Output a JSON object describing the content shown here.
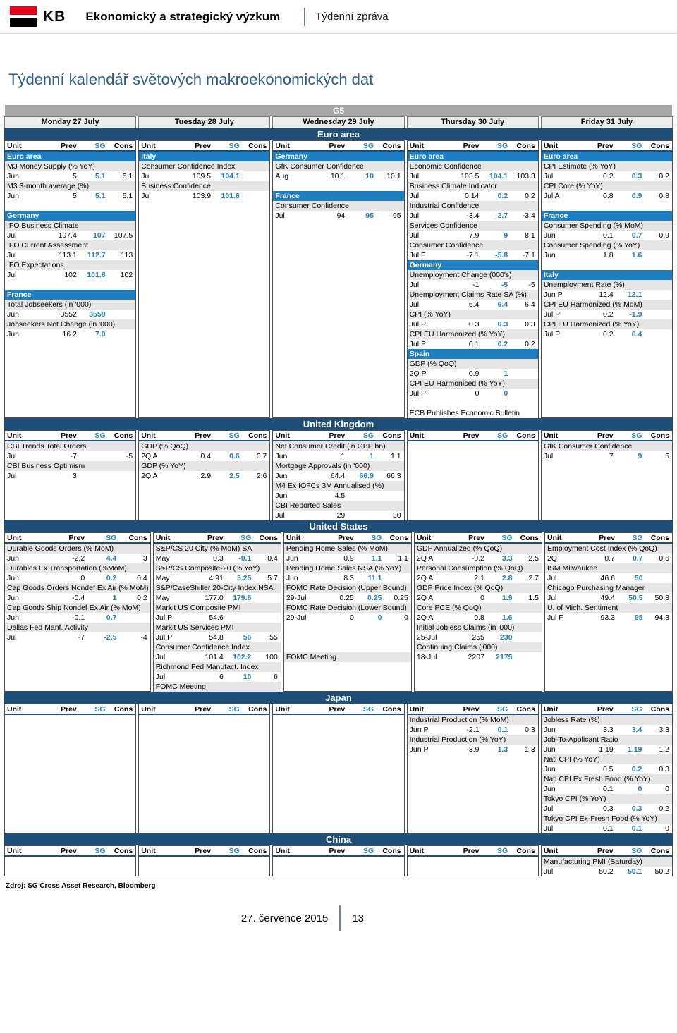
{
  "header": {
    "logo_text": "KB",
    "title": "Ekonomický a strategický výzkum",
    "subtitle": "Týdenní zpráva"
  },
  "page_title": "Týdenní kalendář světových makroekonomických dat",
  "group_band": "G5",
  "days": [
    "Monday 27 July",
    "Tuesday 28 July",
    "Wednesday 29 July",
    "Thursday 30 July",
    "Friday 31 July"
  ],
  "columns": {
    "unit": "Unit",
    "prev": "Prev",
    "sg": "SG",
    "cons": "Cons"
  },
  "regions": {
    "euro": "Euro area",
    "uk": "United Kingdom",
    "us": "United States",
    "japan": "Japan",
    "china": "China"
  },
  "euro_area": {
    "mon": [
      {
        "type": "sub",
        "text": "Euro area"
      },
      {
        "type": "evt",
        "text": "M3 Money Supply (% YoY)"
      },
      {
        "type": "val",
        "unit": "Jun",
        "prev": "5",
        "sg": "5.1",
        "cons": "5.1"
      },
      {
        "type": "evt",
        "text": "M3 3-month average (%)"
      },
      {
        "type": "val",
        "unit": "Jun",
        "prev": "5",
        "sg": "5.1",
        "cons": "5.1"
      },
      {
        "type": "spacer"
      },
      {
        "type": "sub",
        "text": "Germany"
      },
      {
        "type": "evt",
        "text": "IFO Business Climate"
      },
      {
        "type": "val",
        "unit": "Jul",
        "prev": "107.4",
        "sg": "107",
        "cons": "107.5"
      },
      {
        "type": "evt",
        "text": "IFO Current Assessment"
      },
      {
        "type": "val",
        "unit": "Jul",
        "prev": "113.1",
        "sg": "112.7",
        "cons": "113"
      },
      {
        "type": "evt",
        "text": "IFO Expectations"
      },
      {
        "type": "val",
        "unit": "Jul",
        "prev": "102",
        "sg": "101.8",
        "cons": "102"
      },
      {
        "type": "spacer"
      },
      {
        "type": "sub",
        "text": "France"
      },
      {
        "type": "evt",
        "text": "Total Jobseekers (in '000)"
      },
      {
        "type": "val",
        "unit": "Jun",
        "prev": "3552",
        "sg": "3559",
        "cons": ""
      },
      {
        "type": "evt",
        "text": "Jobseekers Net Change (in '000)"
      },
      {
        "type": "val",
        "unit": "Jun",
        "prev": "16.2",
        "sg": "7.0",
        "cons": ""
      }
    ],
    "tue": [
      {
        "type": "sub",
        "text": "Italy"
      },
      {
        "type": "evt",
        "text": "Consumer Confidence Index"
      },
      {
        "type": "val",
        "unit": "Jul",
        "prev": "109.5",
        "sg": "104.1",
        "cons": ""
      },
      {
        "type": "evt",
        "text": "Business Confidence"
      },
      {
        "type": "val",
        "unit": "Jul",
        "prev": "103.9",
        "sg": "101.6",
        "cons": ""
      }
    ],
    "wed": [
      {
        "type": "sub",
        "text": "Germany"
      },
      {
        "type": "evt",
        "text": "GfK Consumer Confidence"
      },
      {
        "type": "val",
        "unit": "Aug",
        "prev": "10.1",
        "sg": "10",
        "cons": "10.1"
      },
      {
        "type": "spacer"
      },
      {
        "type": "sub",
        "text": "France"
      },
      {
        "type": "evt",
        "text": "Consumer Confidence"
      },
      {
        "type": "val",
        "unit": "Jul",
        "prev": "94",
        "sg": "95",
        "cons": "95"
      }
    ],
    "thu": [
      {
        "type": "sub",
        "text": "Euro area"
      },
      {
        "type": "evt",
        "text": "Economic Confidence"
      },
      {
        "type": "val",
        "unit": "Jul",
        "prev": "103.5",
        "sg": "104.1",
        "cons": "103.3"
      },
      {
        "type": "evt",
        "text": "Business Climate Indicator"
      },
      {
        "type": "val",
        "unit": "Jul",
        "prev": "0.14",
        "sg": "0.2",
        "cons": "0.2"
      },
      {
        "type": "evt",
        "text": "Industrial Confidence"
      },
      {
        "type": "val",
        "unit": "Jul",
        "prev": "-3.4",
        "sg": "-2.7",
        "cons": "-3.4"
      },
      {
        "type": "evt",
        "text": "Services Confidence"
      },
      {
        "type": "val",
        "unit": "Jul",
        "prev": "7.9",
        "sg": "9",
        "cons": "8.1"
      },
      {
        "type": "evt",
        "text": "Consumer Confidence"
      },
      {
        "type": "val",
        "unit": "Jul F",
        "prev": "-7.1",
        "sg": "-5.8",
        "cons": "-7.1"
      },
      {
        "type": "sub",
        "text": "Germany"
      },
      {
        "type": "evt",
        "text": "Unemployment Change (000's)"
      },
      {
        "type": "val",
        "unit": "Jul",
        "prev": "-1",
        "sg": "-5",
        "cons": "-5"
      },
      {
        "type": "evt",
        "text": "Unemployment Claims Rate SA (%)"
      },
      {
        "type": "val",
        "unit": "Jul",
        "prev": "6.4",
        "sg": "6.4",
        "cons": "6.4"
      },
      {
        "type": "evt",
        "text": "CPI (% YoY)"
      },
      {
        "type": "val",
        "unit": "Jul P",
        "prev": "0.3",
        "sg": "0.3",
        "cons": "0.3"
      },
      {
        "type": "evt",
        "text": "CPI EU Harmonized (% YoY)"
      },
      {
        "type": "val",
        "unit": "Jul P",
        "prev": "0.1",
        "sg": "0.2",
        "cons": "0.2"
      },
      {
        "type": "sub",
        "text": "Spain"
      },
      {
        "type": "evt",
        "text": "GDP (% QoQ)"
      },
      {
        "type": "val",
        "unit": "2Q P",
        "prev": "0.9",
        "sg": "1",
        "cons": ""
      },
      {
        "type": "evt",
        "text": "CPI EU Harmonised (% YoY)"
      },
      {
        "type": "val",
        "unit": "Jul P",
        "prev": "0",
        "sg": "0",
        "cons": ""
      },
      {
        "type": "spacer"
      },
      {
        "type": "note-wide",
        "text": "ECB Publishes Economic Bulletin"
      }
    ],
    "fri": [
      {
        "type": "sub",
        "text": "Euro area"
      },
      {
        "type": "evt",
        "text": "CPI Estimate (% YoY)"
      },
      {
        "type": "val",
        "unit": "Jul",
        "prev": "0.2",
        "sg": "0.3",
        "cons": "0.2"
      },
      {
        "type": "evt",
        "text": "CPI Core (% YoY)"
      },
      {
        "type": "val",
        "unit": "Jul A",
        "prev": "0.8",
        "sg": "0.9",
        "cons": "0.8"
      },
      {
        "type": "spacer"
      },
      {
        "type": "sub",
        "text": "France"
      },
      {
        "type": "evt",
        "text": "Consumer Spending (% MoM)"
      },
      {
        "type": "val",
        "unit": "Jun",
        "prev": "0.1",
        "sg": "0.7",
        "cons": "0.9"
      },
      {
        "type": "evt",
        "text": "Consumer Spending (% YoY)"
      },
      {
        "type": "val",
        "unit": "Jun",
        "prev": "1.8",
        "sg": "1.6",
        "cons": ""
      },
      {
        "type": "spacer"
      },
      {
        "type": "sub",
        "text": "Italy"
      },
      {
        "type": "evt",
        "text": "Unemployment Rate (%)"
      },
      {
        "type": "val",
        "unit": "Jun P",
        "prev": "12.4",
        "sg": "12.1",
        "cons": ""
      },
      {
        "type": "evt",
        "text": "CPI EU Harmonized (% MoM)"
      },
      {
        "type": "val",
        "unit": "Jul P",
        "prev": "0.2",
        "sg": "-1.9",
        "cons": ""
      },
      {
        "type": "evt",
        "text": "CPI EU Harmonized (% YoY)"
      },
      {
        "type": "val",
        "unit": "Jul P",
        "prev": "0.2",
        "sg": "0.4",
        "cons": ""
      }
    ]
  },
  "uk": {
    "mon": [
      {
        "type": "evt",
        "text": "CBI Trends Total Orders"
      },
      {
        "type": "val",
        "unit": "Jul",
        "prev": "-7",
        "sg": "",
        "cons": "-5"
      },
      {
        "type": "evt",
        "text": "CBI Business Optimism"
      },
      {
        "type": "val",
        "unit": "Jul",
        "prev": "3",
        "sg": "",
        "cons": ""
      }
    ],
    "tue": [
      {
        "type": "evt",
        "text": "GDP (% QoQ)"
      },
      {
        "type": "val",
        "unit": "2Q A",
        "prev": "0.4",
        "sg": "0.6",
        "cons": "0.7"
      },
      {
        "type": "evt",
        "text": "GDP (% YoY)"
      },
      {
        "type": "val",
        "unit": "2Q A",
        "prev": "2.9",
        "sg": "2.5",
        "cons": "2.6"
      }
    ],
    "wed": [
      {
        "type": "evt",
        "text": "Net Consumer Credit (in GBP bn)"
      },
      {
        "type": "val",
        "unit": "Jun",
        "prev": "1",
        "sg": "1",
        "cons": "1.1"
      },
      {
        "type": "evt",
        "text": "Mortgage Approvals (in '000)"
      },
      {
        "type": "val",
        "unit": "Jun",
        "prev": "64.4",
        "sg": "66.9",
        "cons": "66.3"
      },
      {
        "type": "evt",
        "text": "M4 Ex IOFCs 3M Annualised (%)"
      },
      {
        "type": "val",
        "unit": "Jun",
        "prev": "4.5",
        "sg": "",
        "cons": ""
      },
      {
        "type": "evt",
        "text": "CBI Reported Sales"
      },
      {
        "type": "val",
        "unit": "Jul",
        "prev": "29",
        "sg": "",
        "cons": "30"
      }
    ],
    "thu": [],
    "fri": [
      {
        "type": "evt",
        "text": "GfK Consumer Confidence"
      },
      {
        "type": "val",
        "unit": "Jul",
        "prev": "7",
        "sg": "9",
        "cons": "5"
      }
    ]
  },
  "us": {
    "mon": [
      {
        "type": "evt",
        "text": "Durable Goods Orders (% MoM)"
      },
      {
        "type": "val",
        "unit": "Jun",
        "prev": "-2.2",
        "sg": "4.4",
        "cons": "3"
      },
      {
        "type": "evt",
        "text": "Durables Ex Transportation (%MoM)"
      },
      {
        "type": "val",
        "unit": "Jun",
        "prev": "0",
        "sg": "0.2",
        "cons": "0.4"
      },
      {
        "type": "evt",
        "text": "Cap Goods Orders Nondef Ex Air (% MoM)"
      },
      {
        "type": "val",
        "unit": "Jun",
        "prev": "-0.4",
        "sg": "1",
        "cons": "0.2"
      },
      {
        "type": "evt",
        "text": "Cap Goods Ship Nondef Ex Air (% MoM)"
      },
      {
        "type": "val",
        "unit": "Jun",
        "prev": "-0.1",
        "sg": "0.7",
        "cons": ""
      },
      {
        "type": "evt",
        "text": "Dallas Fed Manf. Activity"
      },
      {
        "type": "val",
        "unit": "Jul",
        "prev": "-7",
        "sg": "-2.5",
        "cons": "-4"
      }
    ],
    "tue": [
      {
        "type": "evt",
        "text": "S&P/CS 20 City (% MoM) SA"
      },
      {
        "type": "val",
        "unit": "May",
        "prev": "0.3",
        "sg": "-0.1",
        "cons": "0.4"
      },
      {
        "type": "evt",
        "text": "S&P/CS Composite-20 (% YoY)"
      },
      {
        "type": "val",
        "unit": "May",
        "prev": "4.91",
        "sg": "5.25",
        "cons": "5.7"
      },
      {
        "type": "evt",
        "text": "S&P/CaseShiller 20-City Index NSA"
      },
      {
        "type": "val",
        "unit": "May",
        "prev": "177.0",
        "sg": "179.6",
        "cons": ""
      },
      {
        "type": "evt",
        "text": "Markit US Composite PMI"
      },
      {
        "type": "val",
        "unit": "Jul P",
        "prev": "54.6",
        "sg": "",
        "cons": ""
      },
      {
        "type": "evt",
        "text": "Markit US Services PMI"
      },
      {
        "type": "val",
        "unit": "Jul P",
        "prev": "54.8",
        "sg": "56",
        "cons": "55"
      },
      {
        "type": "evt",
        "text": "Consumer Confidence Index"
      },
      {
        "type": "val",
        "unit": "Jul",
        "prev": "101.4",
        "sg": "102.2",
        "cons": "100"
      },
      {
        "type": "evt",
        "text": "Richmond Fed Manufact. Index"
      },
      {
        "type": "val",
        "unit": "Jul",
        "prev": "6",
        "sg": "10",
        "cons": "6"
      },
      {
        "type": "evt",
        "text": "FOMC Meeting"
      }
    ],
    "wed": [
      {
        "type": "evt",
        "text": "Pending Home Sales (% MoM)"
      },
      {
        "type": "val",
        "unit": "Jun",
        "prev": "0.9",
        "sg": "1.1",
        "cons": "1.1"
      },
      {
        "type": "evt",
        "text": "Pending Home Sales NSA (% YoY)"
      },
      {
        "type": "val",
        "unit": "Jun",
        "prev": "8.3",
        "sg": "11.1",
        "cons": ""
      },
      {
        "type": "evt",
        "text": "FOMC Rate Decision (Upper Bound)"
      },
      {
        "type": "val",
        "unit": "29-Jul",
        "prev": "0.25",
        "sg": "0.25",
        "cons": "0.25"
      },
      {
        "type": "evt",
        "text": "FOMC Rate Decision (Lower Bound)"
      },
      {
        "type": "val",
        "unit": "29-Jul",
        "prev": "0",
        "sg": "0",
        "cons": "0"
      },
      {
        "type": "spacer"
      },
      {
        "type": "spacer"
      },
      {
        "type": "spacer"
      },
      {
        "type": "evt",
        "text": "FOMC Meeting"
      }
    ],
    "thu": [
      {
        "type": "evt",
        "text": "GDP Annualized (% QoQ)"
      },
      {
        "type": "val",
        "unit": "2Q A",
        "prev": "-0.2",
        "sg": "3.3",
        "cons": "2.5"
      },
      {
        "type": "evt",
        "text": "Personal Consumption (% QoQ)"
      },
      {
        "type": "val",
        "unit": "2Q A",
        "prev": "2.1",
        "sg": "2.8",
        "cons": "2.7"
      },
      {
        "type": "evt",
        "text": "GDP Price Index (% QoQ)"
      },
      {
        "type": "val",
        "unit": "2Q A",
        "prev": "0",
        "sg": "1.9",
        "cons": "1.5"
      },
      {
        "type": "evt",
        "text": "Core PCE (% QoQ)"
      },
      {
        "type": "val",
        "unit": "2Q A",
        "prev": "0.8",
        "sg": "1.6",
        "cons": ""
      },
      {
        "type": "evt",
        "text": "Initial Jobless Claims (in '000)"
      },
      {
        "type": "val",
        "unit": "25-Jul",
        "prev": "255",
        "sg": "230",
        "cons": ""
      },
      {
        "type": "evt",
        "text": "Continuing Claims ('000)"
      },
      {
        "type": "val",
        "unit": "18-Jul",
        "prev": "2207",
        "sg": "2175",
        "cons": ""
      }
    ],
    "fri": [
      {
        "type": "evt",
        "text": "Employment Cost Index (% QoQ)"
      },
      {
        "type": "val",
        "unit": "2Q",
        "prev": "0.7",
        "sg": "0.7",
        "cons": "0.6"
      },
      {
        "type": "evt",
        "text": "ISM Milwaukee"
      },
      {
        "type": "val",
        "unit": "Jul",
        "prev": "46.6",
        "sg": "50",
        "cons": ""
      },
      {
        "type": "evt",
        "text": "Chicago Purchasing Manager"
      },
      {
        "type": "val",
        "unit": "Jul",
        "prev": "49.4",
        "sg": "50.5",
        "cons": "50.8"
      },
      {
        "type": "evt",
        "text": "U. of Mich. Sentiment"
      },
      {
        "type": "val",
        "unit": "Jul F",
        "prev": "93.3",
        "sg": "95",
        "cons": "94.3"
      }
    ]
  },
  "japan": {
    "mon": [],
    "tue": [],
    "wed": [],
    "thu": [
      {
        "type": "evt",
        "text": "Industrial Production (% MoM)"
      },
      {
        "type": "val",
        "unit": "Jun P",
        "prev": "-2.1",
        "sg": "0.1",
        "cons": "0.3"
      },
      {
        "type": "evt",
        "text": "Industrial Production (% YoY)"
      },
      {
        "type": "val",
        "unit": "Jun P",
        "prev": "-3.9",
        "sg": "1.3",
        "cons": "1.3"
      }
    ],
    "fri": [
      {
        "type": "evt",
        "text": "Jobless Rate (%)"
      },
      {
        "type": "val",
        "unit": "Jun",
        "prev": "3.3",
        "sg": "3.4",
        "cons": "3.3"
      },
      {
        "type": "evt",
        "text": "Job-To-Applicant Ratio"
      },
      {
        "type": "val",
        "unit": "Jun",
        "prev": "1.19",
        "sg": "1.19",
        "cons": "1.2"
      },
      {
        "type": "evt",
        "text": "Natl CPI (% YoY)"
      },
      {
        "type": "val",
        "unit": "Jun",
        "prev": "0.5",
        "sg": "0.2",
        "cons": "0.3"
      },
      {
        "type": "evt",
        "text": "Natl CPI Ex Fresh Food (% YoY)"
      },
      {
        "type": "val",
        "unit": "Jun",
        "prev": "0.1",
        "sg": "0",
        "cons": "0"
      },
      {
        "type": "evt",
        "text": "Tokyo CPI (% YoY)"
      },
      {
        "type": "val",
        "unit": "Jul",
        "prev": "0.3",
        "sg": "0.3",
        "cons": "0.2"
      },
      {
        "type": "evt",
        "text": "Tokyo CPI Ex-Fresh Food (% YoY)"
      },
      {
        "type": "val",
        "unit": "Jul",
        "prev": "0.1",
        "sg": "0.1",
        "cons": "0"
      }
    ]
  },
  "china": {
    "mon": [],
    "tue": [],
    "wed": [],
    "thu": [],
    "fri": [
      {
        "type": "evt",
        "text": "Manufacturing PMI (Saturday)"
      },
      {
        "type": "val",
        "unit": "Jul",
        "prev": "50.2",
        "sg": "50.1",
        "cons": "50.2"
      }
    ]
  },
  "source_note": "Zdroj: SG Cross Asset Research, Bloomberg",
  "footer": {
    "date": "27. července 2015",
    "page": "13"
  },
  "colors": {
    "brand_red": "#e2001a",
    "region_band": "#1f4e79",
    "sub_band": "#1e7fc2",
    "sg_blue": "#1e7fc2",
    "title_blue": "#2b5d8a",
    "group_band": "#a6a6a6"
  }
}
